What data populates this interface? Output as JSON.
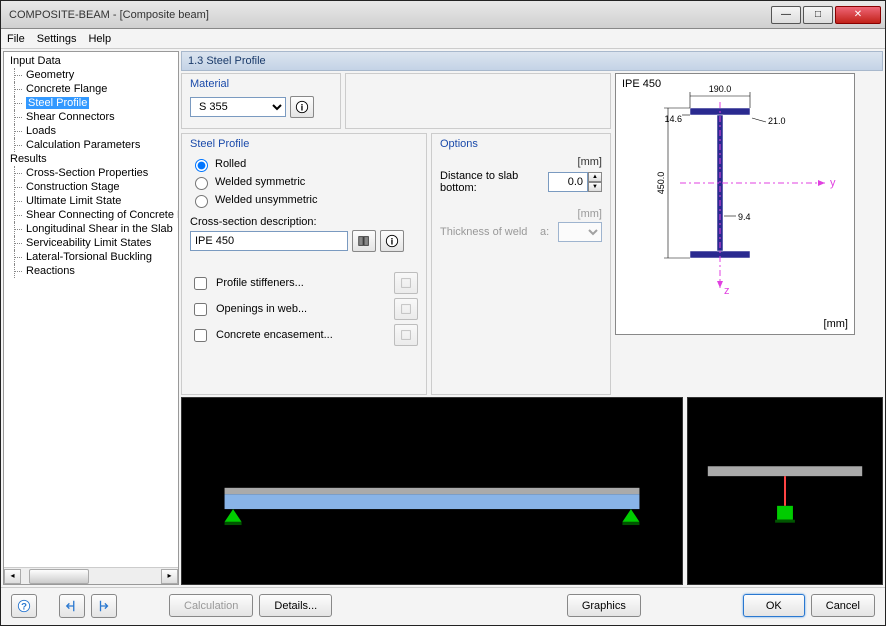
{
  "window": {
    "title": "COMPOSITE-BEAM - [Composite beam]"
  },
  "menu": {
    "file": "File",
    "settings": "Settings",
    "help": "Help"
  },
  "tree": {
    "input": "Input Data",
    "input_items": [
      "Geometry",
      "Concrete Flange",
      "Steel Profile",
      "Shear Connectors",
      "Loads",
      "Calculation Parameters"
    ],
    "results": "Results",
    "results_items": [
      "Cross-Section Properties",
      "Construction Stage",
      "Ultimate Limit State",
      "Shear Connecting of Concrete Flange",
      "Longitudinal Shear in the Slab",
      "Serviceability Limit States",
      "Lateral-Torsional Buckling",
      "Reactions"
    ],
    "selected_index": 2
  },
  "heading": "1.3 Steel Profile",
  "material": {
    "title": "Material",
    "value": "S 355"
  },
  "steel_profile": {
    "title": "Steel Profile",
    "radio": {
      "rolled": "Rolled",
      "welded_sym": "Welded symmetric",
      "welded_unsym": "Welded unsymmetric"
    },
    "selected": "rolled",
    "cs_label": "Cross-section description:",
    "cs_value": "IPE 450",
    "chk_stiffeners": "Profile stiffeners...",
    "chk_openings": "Openings in web...",
    "chk_concrete": "Concrete encasement..."
  },
  "options": {
    "title": "Options",
    "dist_label": "Distance to slab bottom:",
    "dist_value": "0.0",
    "unit": "[mm]",
    "thickness_label": "Thickness of weld",
    "a_label": "a:"
  },
  "profile_view": {
    "name": "IPE 450",
    "unit": "[mm]",
    "dims": {
      "width": "190.0",
      "height": "450.0",
      "tf": "14.6",
      "tw": "9.4",
      "r": "21.0"
    },
    "axes": {
      "y": "y",
      "z": "z"
    }
  },
  "footer": {
    "calculation": "Calculation",
    "details": "Details...",
    "graphics": "Graphics",
    "ok": "OK",
    "cancel": "Cancel"
  }
}
